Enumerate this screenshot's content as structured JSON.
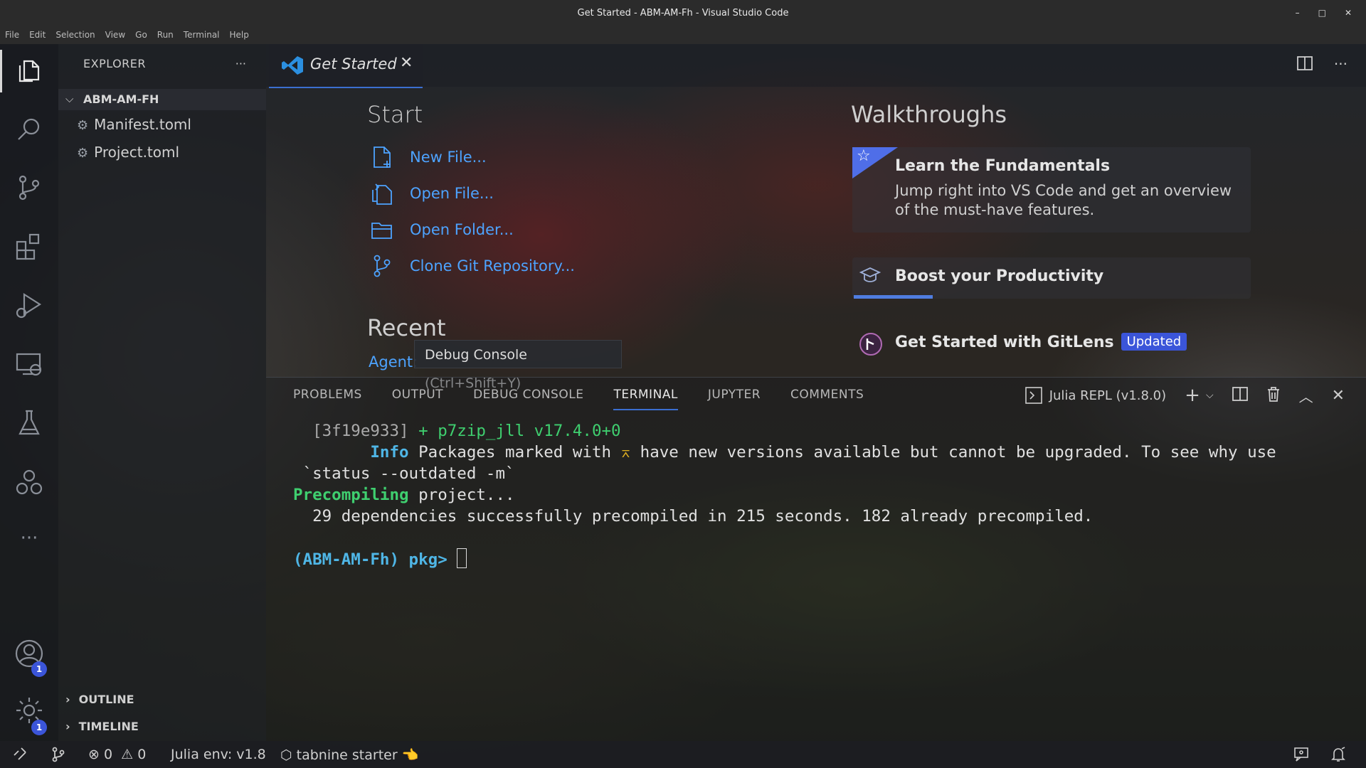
{
  "window": {
    "title": "Get Started - ABM-AM-Fh - Visual Studio Code",
    "controls": [
      "–",
      "□",
      "✕"
    ]
  },
  "menu": [
    "File",
    "Edit",
    "Selection",
    "View",
    "Go",
    "Run",
    "Terminal",
    "Help"
  ],
  "activity_bar": {
    "icons": [
      "files-icon",
      "search-icon",
      "source-control-icon",
      "extensions-icon",
      "run-debug-icon",
      "remote-explorer-icon",
      "testing-icon",
      "julia-icon",
      "more-icon",
      "account-icon",
      "settings-gear-icon"
    ],
    "account_badge": "1",
    "settings_badge": "1",
    "more_label": "···"
  },
  "sidebar": {
    "header": "EXPLORER",
    "more": "···",
    "folder": "ABM-AM-FH",
    "files": [
      "Manifest.toml",
      "Project.toml"
    ],
    "sections": [
      "OUTLINE",
      "TIMELINE"
    ]
  },
  "editor": {
    "tab_label": "Get Started",
    "tab_close": "✕",
    "actions_more": "···"
  },
  "welcome": {
    "start_heading": "Start",
    "start_items": [
      "New File...",
      "Open File...",
      "Open Folder...",
      "Clone Git Repository..."
    ],
    "recent_heading": "Recent",
    "recent_item": "Agent:",
    "walkthroughs_heading": "Walkthroughs",
    "walkthroughs": [
      {
        "title": "Learn the Fundamentals",
        "desc": "Jump right into VS Code and get an overview of the must-have features."
      },
      {
        "title": "Boost your Productivity",
        "progress": 0.2
      },
      {
        "title": "Get Started with GitLens",
        "badge": "Updated"
      }
    ]
  },
  "tooltip": "Debug Console (Ctrl+Shift+Y)",
  "panel": {
    "tabs": [
      "PROBLEMS",
      "OUTPUT",
      "DEBUG CONSOLE",
      "TERMINAL",
      "JUPYTER",
      "COMMENTS"
    ],
    "active_tab": "TERMINAL",
    "terminal_name": "Julia REPL (v1.8.0)",
    "lines": {
      "l1_hash": "  [3f19e933]",
      "l1_pkg": " + p7zip_jll v17.4.0+0",
      "l2_info": "        Info",
      "l2_rest": " Packages marked with ",
      "l2_sym": "⌅",
      "l2_tail": " have new versions available but cannot be upgraded. To see why use",
      "l3": " `status --outdated -m`",
      "l4_pre": "Precompiling",
      "l4_rest": " project...",
      "l5": "  29 dependencies successfully precompiled in 215 seconds. 182 already precompiled.",
      "prompt": "(ABM-AM-Fh) pkg> "
    }
  },
  "statusbar": {
    "errors": "0",
    "warnings": "0",
    "julia_env": "Julia env: v1.8",
    "tabnine": "tabnine starter",
    "tabnine_emoji": "👈"
  },
  "colors": {
    "accent": "#3b6fd1",
    "link": "#4da3ff",
    "badge": "#3b55d9",
    "terminal_green": "#3fcf6f"
  }
}
